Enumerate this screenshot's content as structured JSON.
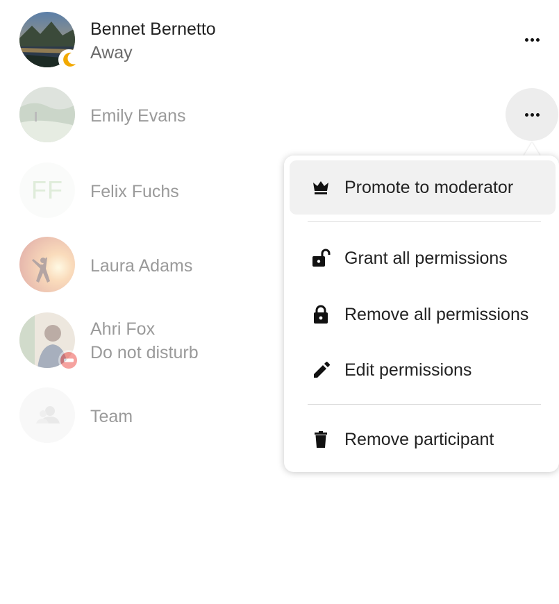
{
  "participants": [
    {
      "name": "Bennet Bernetto",
      "status": "Away",
      "avatar": "landscape-photo-avatar",
      "status_icon": "moon-icon",
      "status_color": "#f2a900"
    },
    {
      "name": "Emily Evans",
      "avatar": "landscape-photo-avatar"
    },
    {
      "name": "Felix Fuchs",
      "initials": "FF"
    },
    {
      "name": "Laura Adams",
      "avatar": "sunset-photo-avatar"
    },
    {
      "name": "Ahri Fox",
      "status": "Do not disturb",
      "avatar": "person-photo-avatar",
      "status_icon": "minus-circle-icon",
      "status_color": "#e9322d"
    },
    {
      "name": "Team",
      "avatar": "group-icon"
    }
  ],
  "menu": {
    "items": [
      {
        "label": "Promote to moderator",
        "icon": "crown-icon"
      },
      {
        "label": "Grant all permissions",
        "icon": "lock-open-icon"
      },
      {
        "label": "Remove all permissions",
        "icon": "lock-icon"
      },
      {
        "label": "Edit permissions",
        "icon": "pencil-icon"
      },
      {
        "label": "Remove participant",
        "icon": "trash-icon"
      }
    ]
  },
  "colors": {
    "accent_highlight": "#f1f1f1",
    "text": "#222222",
    "muted_text": "#9a9a9a"
  }
}
